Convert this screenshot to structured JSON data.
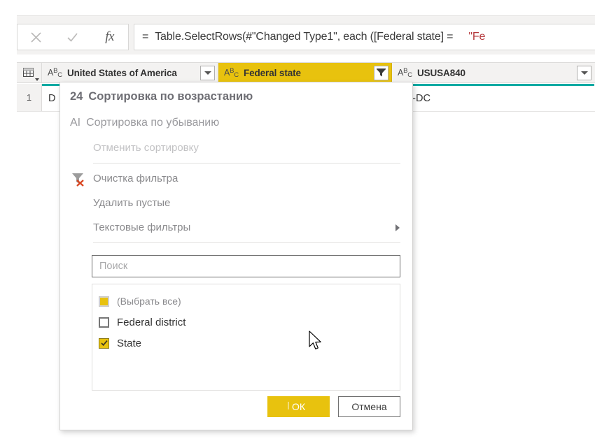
{
  "formula_bar": {
    "cancel_icon": "close-icon",
    "accept_icon": "check-icon",
    "function_icon": "fx-icon",
    "prefix": "=",
    "expression": "Table.SelectRows(#\"Changed Type1\", each ([Federal state] =",
    "string_literal": "\"Fe"
  },
  "grid": {
    "corner_icon": "table-icon",
    "columns": [
      {
        "type_tag": "ABC",
        "name": "United States of America",
        "button_icon": "chevron-down-icon",
        "filtered": false
      },
      {
        "type_tag": "ABC",
        "name": "Federal state",
        "button_icon": "filter-icon",
        "filtered": true
      },
      {
        "type_tag": "ABC",
        "name": "USUSA840",
        "button_icon": "chevron-down-icon",
        "filtered": false
      }
    ],
    "rows": [
      {
        "number": "1",
        "cells": [
          "D",
          "",
          "US-DC"
        ]
      }
    ]
  },
  "filter_dropdown": {
    "menu_items": [
      {
        "label": "Сортировка по возрастанию",
        "glyph": "24",
        "icon": "sort-ascending-icon",
        "disabled": false
      },
      {
        "label": "Сортировка по убыванию",
        "glyph": "AI",
        "icon": "sort-descending-icon",
        "disabled": false
      },
      {
        "label": "Отменить сортировку",
        "glyph": "",
        "icon": "clear-sort-icon",
        "disabled": true
      },
      {
        "label": "Очистка фильтра",
        "glyph": "",
        "icon": "clear-filter-icon",
        "disabled": false
      },
      {
        "label": "Удалить пустые",
        "glyph": "",
        "icon": "remove-empty-icon",
        "disabled": false
      },
      {
        "label": "Текстовые фильтры",
        "glyph": "",
        "icon": "text-filters-icon",
        "disabled": false,
        "has_submenu": true
      }
    ],
    "search": {
      "placeholder": "Поиск",
      "value": ""
    },
    "value_list": [
      {
        "label": "(Выбрать все)",
        "state": "indeterminate",
        "muted": true
      },
      {
        "label": "Federal district",
        "state": "unchecked",
        "muted": false
      },
      {
        "label": "State",
        "state": "checked",
        "muted": false
      }
    ],
    "buttons": {
      "ok": "ОК",
      "cancel": "Отмена"
    }
  },
  "colors": {
    "accent_gold": "#e8c20e",
    "selection_teal": "#00A9A2",
    "chrome_gray": "#f3f2f1",
    "string_red": "#b5383c"
  },
  "cursor": {
    "icon": "mouse-pointer-icon"
  }
}
